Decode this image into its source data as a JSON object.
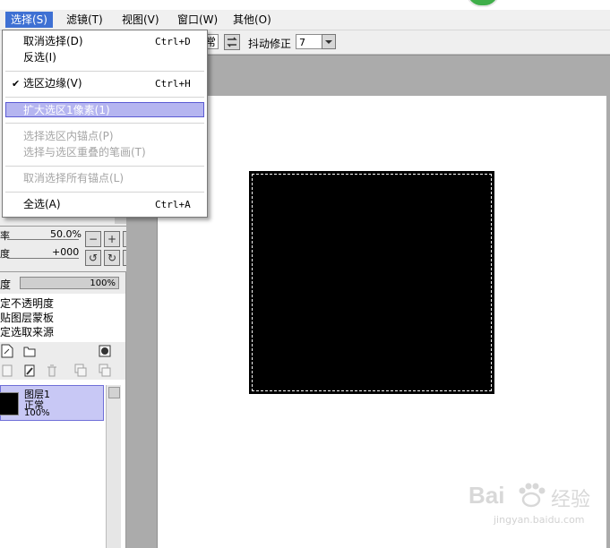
{
  "menubar": {
    "items": [
      {
        "label": "选择(S)",
        "active": true
      },
      {
        "label": "滤镜(T)",
        "active": false
      },
      {
        "label": "视图(V)",
        "active": false
      },
      {
        "label": "窗口(W)",
        "active": false
      },
      {
        "label": "其他(O)",
        "active": false
      }
    ]
  },
  "toolbar": {
    "blend_partial": "常",
    "stabilizer_label": "抖动修正",
    "stabilizer_value": "7"
  },
  "dropdown": {
    "items": [
      {
        "label": "取消选择(D)",
        "shortcut": "Ctrl+D",
        "disabled": false
      },
      {
        "label": "反选(I)",
        "shortcut": "",
        "disabled": false
      },
      {
        "label": "选区边缘(V)",
        "shortcut": "Ctrl+H",
        "checked": true
      },
      {
        "label": "扩大选区1像素(1)",
        "shortcut": "",
        "disabled": false,
        "highlight": true
      },
      {
        "label": "选择选区内锚点(P)",
        "shortcut": "",
        "disabled": true
      },
      {
        "label": "选择与选区重叠的笔画(T)",
        "shortcut": "",
        "disabled": true
      },
      {
        "label": "取消选择所有锚点(L)",
        "shortcut": "",
        "disabled": true
      },
      {
        "label": "全选(A)",
        "shortcut": "Ctrl+A",
        "disabled": false
      }
    ]
  },
  "navigator": {
    "zoom_label": "率",
    "zoom_value": "50.0%",
    "angle_label": "度",
    "angle_value": "+000"
  },
  "layer_panel": {
    "opacity_label": "度",
    "opacity_value": "100%",
    "options": [
      "定不透明度",
      "贴图层蒙板",
      "定选取来源"
    ],
    "layer": {
      "name": "图层1",
      "mode": "正常",
      "opacity": "100%"
    }
  },
  "watermark": {
    "brand_en": "Bai",
    "brand_cn": "经验",
    "url": "jingyan.baidu.com"
  }
}
